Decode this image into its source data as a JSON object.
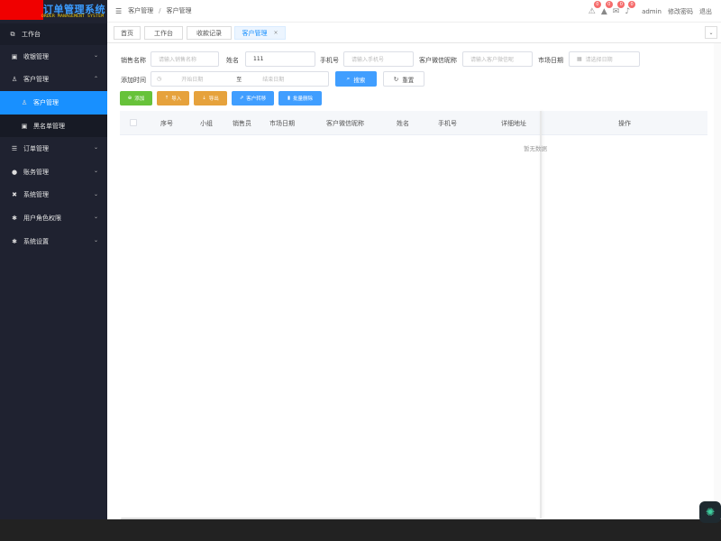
{
  "logo": {
    "title": "订单管理系统",
    "subtitle": "ORDER MANAGEMENT SYSTEM"
  },
  "sidebar": {
    "items": [
      {
        "label": "工作台",
        "icon": "workbench-icon"
      },
      {
        "label": "收银管理",
        "icon": "cashier-icon"
      },
      {
        "label": "客户管理",
        "icon": "user-icon"
      },
      {
        "label": "客户管理",
        "icon": "customer-icon"
      },
      {
        "label": "黑名单管理",
        "icon": "blacklist-icon"
      },
      {
        "label": "订单管理",
        "icon": "order-icon"
      },
      {
        "label": "账务管理",
        "icon": "account-icon"
      },
      {
        "label": "系统管理",
        "icon": "tools-icon"
      },
      {
        "label": "用户角色权限",
        "icon": "gear-icon"
      },
      {
        "label": "系统设置",
        "icon": "settings-icon"
      }
    ]
  },
  "header": {
    "breadcrumb": [
      "客户管理",
      "客户管理"
    ],
    "badges": [
      "0",
      "0",
      "0",
      "0"
    ],
    "user": "admin",
    "change_password": "修改密码",
    "logout": "退出"
  },
  "tabs": [
    {
      "label": "首页"
    },
    {
      "label": "工作台"
    },
    {
      "label": "收款记录"
    },
    {
      "label": "客户管理",
      "close": "×"
    }
  ],
  "filters": {
    "sales_name_label": "销售名称",
    "sales_name_placeholder": "请输入销售名称",
    "name_label": "姓名",
    "name_value": "111",
    "phone_label": "手机号",
    "phone_placeholder": "请输入手机号",
    "wechat_label": "客户微信昵称",
    "wechat_placeholder": "请输入客户微信昵",
    "market_date_label": "市场日期",
    "market_date_placeholder": "请选择日期",
    "add_time_label": "添加时间",
    "start_date_placeholder": "开始日期",
    "range_sep": "至",
    "end_date_placeholder": "结束日期",
    "search_label": "搜索",
    "reset_label": "重置"
  },
  "actions": {
    "add": "添加",
    "import": "导入",
    "export": "导出",
    "transfer": "客户转移",
    "batch_delete": "批量删除"
  },
  "table": {
    "columns": [
      "序号",
      "小组",
      "销售员",
      "市场日期",
      "客户微信昵称",
      "姓名",
      "手机号",
      "详细地址"
    ],
    "action_column": "操作",
    "empty": "暂无数据"
  },
  "colors": {
    "sidebar_bg": "#1f2230",
    "primary": "#409eff",
    "active_nav": "#1890ff",
    "success": "#67c23a",
    "warning": "#e6a23c"
  }
}
